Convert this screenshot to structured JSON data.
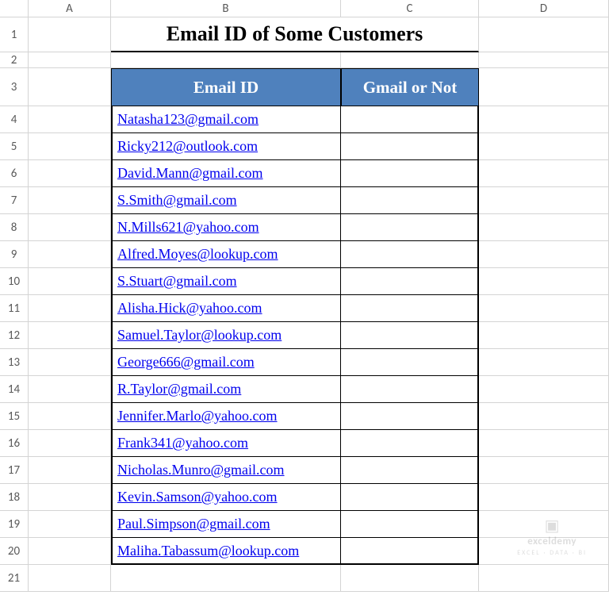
{
  "columns": [
    "A",
    "B",
    "C",
    "D"
  ],
  "title": "Email ID of Some Customers",
  "headers": {
    "email": "Email ID",
    "gmail": "Gmail or Not"
  },
  "rows": [
    {
      "num": "4",
      "email": "Natasha123@gmail.com",
      "gmail": ""
    },
    {
      "num": "5",
      "email": "Ricky212@outlook.com",
      "gmail": ""
    },
    {
      "num": "6",
      "email": "David.Mann@gmail.com",
      "gmail": ""
    },
    {
      "num": "7",
      "email": "S.Smith@gmail.com",
      "gmail": ""
    },
    {
      "num": "8",
      "email": "N.Mills621@yahoo.com",
      "gmail": ""
    },
    {
      "num": "9",
      "email": "Alfred.Moyes@lookup.com",
      "gmail": ""
    },
    {
      "num": "10",
      "email": "S.Stuart@gmail.com",
      "gmail": ""
    },
    {
      "num": "11",
      "email": "Alisha.Hick@yahoo.com",
      "gmail": ""
    },
    {
      "num": "12",
      "email": "Samuel.Taylor@lookup.com",
      "gmail": ""
    },
    {
      "num": "13",
      "email": "George666@gmail.com",
      "gmail": ""
    },
    {
      "num": "14",
      "email": "R.Taylor@gmail.com",
      "gmail": ""
    },
    {
      "num": "15",
      "email": "Jennifer.Marlo@yahoo.com",
      "gmail": ""
    },
    {
      "num": "16",
      "email": "Frank341@yahoo.com",
      "gmail": ""
    },
    {
      "num": "17",
      "email": "Nicholas.Munro@gmail.com",
      "gmail": ""
    },
    {
      "num": "18",
      "email": "Kevin.Samson@yahoo.com",
      "gmail": ""
    },
    {
      "num": "19",
      "email": "Paul.Simpson@gmail.com",
      "gmail": ""
    },
    {
      "num": "20",
      "email": "Maliha.Tabassum@lookup.com",
      "gmail": ""
    }
  ],
  "trailing_row": "21",
  "watermark": {
    "title": "exceldemy",
    "sub": "EXCEL · DATA · BI"
  }
}
